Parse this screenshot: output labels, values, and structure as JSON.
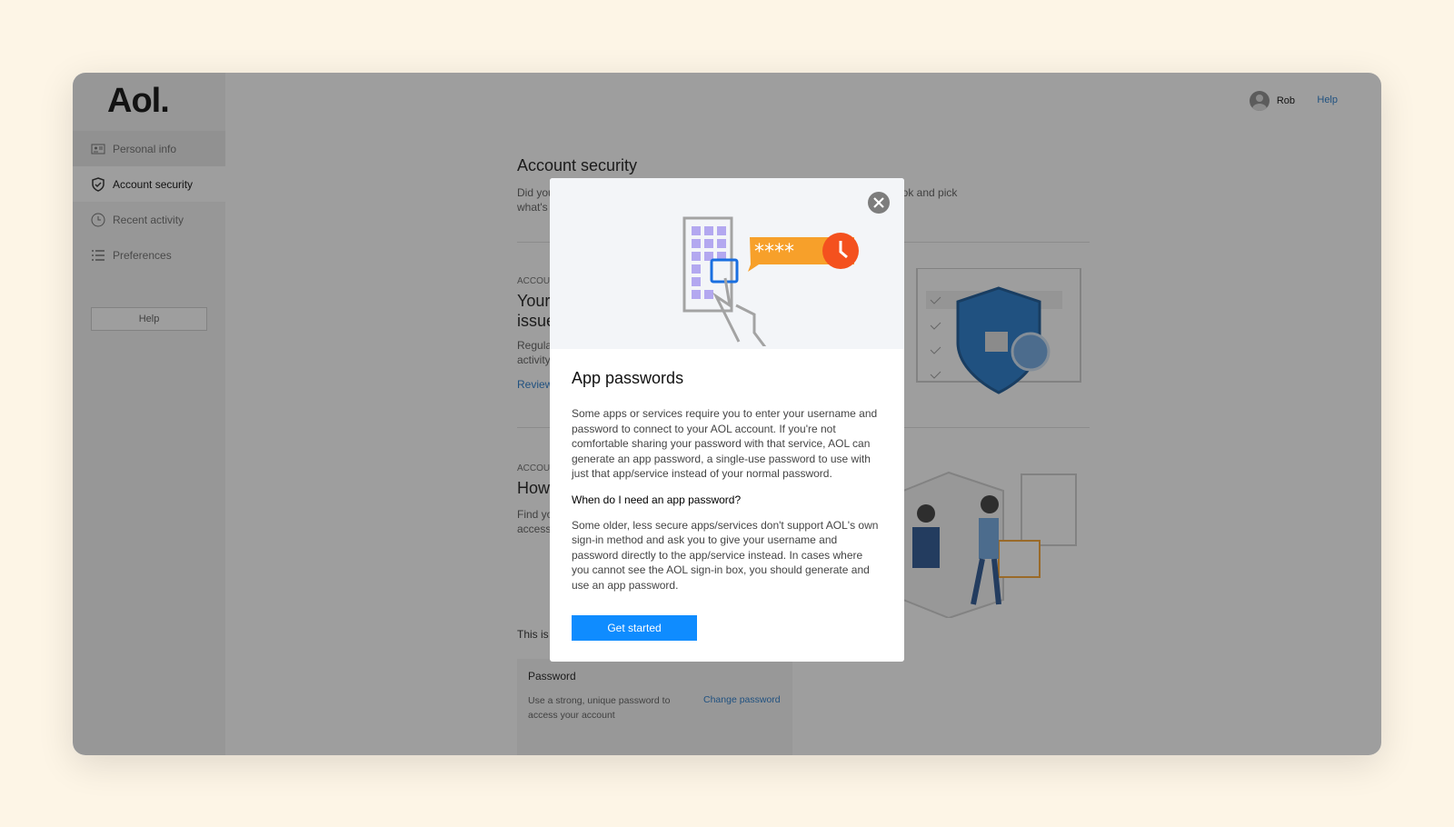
{
  "app": {
    "logo": "Aol."
  },
  "sidebar": {
    "items": [
      {
        "label": "Personal info",
        "icon": "id-card-icon"
      },
      {
        "label": "Account security",
        "icon": "shield-icon"
      },
      {
        "label": "Recent activity",
        "icon": "clock-icon"
      },
      {
        "label": "Preferences",
        "icon": "list-icon"
      }
    ],
    "help": "Help"
  },
  "header": {
    "user": "Rob",
    "help": "Help"
  },
  "main": {
    "title": "Account security",
    "intro_a": "Did you",
    "intro_b": "what's",
    "intro_right": "ook and pick",
    "section1": {
      "caption": "ACCOU",
      "title_a": "Your",
      "title_b": "issue",
      "text_a": "Regula",
      "text_b": "activity",
      "link": "Review"
    },
    "section2": {
      "caption": "ACCOU",
      "title": "How",
      "text_a": "Find yo",
      "text_b": "access"
    },
    "note": "This is",
    "password_card": {
      "title": "Password",
      "text": "Use a strong, unique password to access your account",
      "link": "Change password"
    }
  },
  "modal": {
    "title": "App passwords",
    "body1": "Some apps or services require you to enter your username and password to connect to your AOL account. If you're not comfortable sharing your password with that service, AOL can generate an app password, a single-use password to use with just that app/service instead of your normal password.",
    "question": "When do I need an app password?",
    "body2": "Some older, less secure apps/services don't support AOL's own sign-in method and ask you to give your username and password directly to the app/service instead. In cases where you cannot see the AOL sign-in box, you should generate and use an app password.",
    "button": "Get started",
    "stars": "****"
  },
  "colors": {
    "accent": "#0f8cff",
    "link": "#1a73c8",
    "orange": "#f7a02a",
    "red": "#f4511e",
    "background": "#fdf5e6"
  }
}
